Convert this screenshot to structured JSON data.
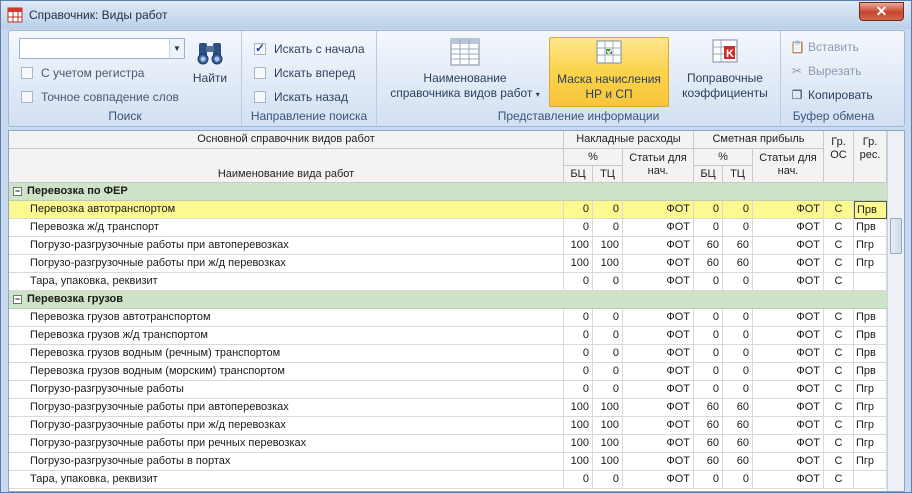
{
  "window": {
    "title": "Справочник: Виды работ",
    "close_glyph": "✕"
  },
  "ribbon": {
    "search": {
      "input_value": "",
      "case_label": "С учетом регистра",
      "exact_label": "Точное совпадение слов",
      "find_label": "Найти",
      "group_label": "Поиск"
    },
    "direction": {
      "from_start": "Искать с начала",
      "forward": "Искать вперед",
      "backward": "Искать назад",
      "group_label": "Направление поиска"
    },
    "view": {
      "name_btn": [
        "Наименование",
        "справочника видов работ"
      ],
      "mask_btn": [
        "Маска начисления",
        "НР и СП"
      ],
      "coef_btn": [
        "Поправочные",
        "коэффициенты"
      ],
      "group_label": "Представление информации"
    },
    "clipboard": {
      "paste": "Вставить",
      "cut": "Вырезать",
      "copy": "Копировать",
      "group_label": "Буфер обмена"
    }
  },
  "grid": {
    "headers": {
      "main": "Основной справочник видов работ",
      "name": "Наименование вида работ",
      "overhead": "Накладные расходы",
      "profit": "Сметная прибыль",
      "pct": "%",
      "pct2": "%",
      "bc": "БЦ",
      "tc": "ТЦ",
      "bc2": "БЦ",
      "tc2": "ТЦ",
      "art": [
        "Статьи для",
        "нач."
      ],
      "art2": [
        "Статьи для",
        "нач."
      ],
      "gr_os": [
        "Гр.",
        "ОС"
      ],
      "gr_res": [
        "Гр.",
        "рес."
      ]
    },
    "groups": [
      {
        "title": "Перевозка по ФЕР",
        "rows": [
          {
            "name": "Перевозка автотранспортом",
            "nr_bc": "0",
            "nr_tc": "0",
            "nr_art": "ФОТ",
            "sp_bc": "0",
            "sp_tc": "0",
            "sp_art": "ФОТ",
            "gr_os": "С",
            "gr_res": "Прв",
            "selected": true
          },
          {
            "name": "Перевозка ж/д транспорт",
            "nr_bc": "0",
            "nr_tc": "0",
            "nr_art": "ФОТ",
            "sp_bc": "0",
            "sp_tc": "0",
            "sp_art": "ФОТ",
            "gr_os": "С",
            "gr_res": "Прв"
          },
          {
            "name": "Погрузо-разгрузочные работы при автоперевозках",
            "nr_bc": "100",
            "nr_tc": "100",
            "nr_art": "ФОТ",
            "sp_bc": "60",
            "sp_tc": "60",
            "sp_art": "ФОТ",
            "gr_os": "С",
            "gr_res": "Пгр"
          },
          {
            "name": "Погрузо-разгрузочные работы при ж/д перевозках",
            "nr_bc": "100",
            "nr_tc": "100",
            "nr_art": "ФОТ",
            "sp_bc": "60",
            "sp_tc": "60",
            "sp_art": "ФОТ",
            "gr_os": "С",
            "gr_res": "Пгр"
          },
          {
            "name": "Тара, упаковка, реквизит",
            "nr_bc": "0",
            "nr_tc": "0",
            "nr_art": "ФОТ",
            "sp_bc": "0",
            "sp_tc": "0",
            "sp_art": "ФОТ",
            "gr_os": "С",
            "gr_res": ""
          }
        ]
      },
      {
        "title": "Перевозка грузов",
        "rows": [
          {
            "name": "Перевозка грузов автотранспортом",
            "nr_bc": "0",
            "nr_tc": "0",
            "nr_art": "ФОТ",
            "sp_bc": "0",
            "sp_tc": "0",
            "sp_art": "ФОТ",
            "gr_os": "С",
            "gr_res": "Прв"
          },
          {
            "name": "Перевозка грузов ж/д транспортом",
            "nr_bc": "0",
            "nr_tc": "0",
            "nr_art": "ФОТ",
            "sp_bc": "0",
            "sp_tc": "0",
            "sp_art": "ФОТ",
            "gr_os": "С",
            "gr_res": "Прв"
          },
          {
            "name": "Перевозка грузов водным (речным) транспортом",
            "nr_bc": "0",
            "nr_tc": "0",
            "nr_art": "ФОТ",
            "sp_bc": "0",
            "sp_tc": "0",
            "sp_art": "ФОТ",
            "gr_os": "С",
            "gr_res": "Прв"
          },
          {
            "name": "Перевозка грузов водным (морским) транспортом",
            "nr_bc": "0",
            "nr_tc": "0",
            "nr_art": "ФОТ",
            "sp_bc": "0",
            "sp_tc": "0",
            "sp_art": "ФОТ",
            "gr_os": "С",
            "gr_res": "Прв"
          },
          {
            "name": "Погрузо-разгрузочные работы",
            "nr_bc": "0",
            "nr_tc": "0",
            "nr_art": "ФОТ",
            "sp_bc": "0",
            "sp_tc": "0",
            "sp_art": "ФОТ",
            "gr_os": "С",
            "gr_res": "Пгр"
          },
          {
            "name": "Погрузо-разгрузочные работы при автоперевозках",
            "nr_bc": "100",
            "nr_tc": "100",
            "nr_art": "ФОТ",
            "sp_bc": "60",
            "sp_tc": "60",
            "sp_art": "ФОТ",
            "gr_os": "С",
            "gr_res": "Пгр"
          },
          {
            "name": "Погрузо-разгрузочные работы при ж/д перевозках",
            "nr_bc": "100",
            "nr_tc": "100",
            "nr_art": "ФОТ",
            "sp_bc": "60",
            "sp_tc": "60",
            "sp_art": "ФОТ",
            "gr_os": "С",
            "gr_res": "Пгр"
          },
          {
            "name": "Погрузо-разгрузочные работы при речных перевозках",
            "nr_bc": "100",
            "nr_tc": "100",
            "nr_art": "ФОТ",
            "sp_bc": "60",
            "sp_tc": "60",
            "sp_art": "ФОТ",
            "gr_os": "С",
            "gr_res": "Пгр"
          },
          {
            "name": "Погрузо-разгрузочные работы в портах",
            "nr_bc": "100",
            "nr_tc": "100",
            "nr_art": "ФОТ",
            "sp_bc": "60",
            "sp_tc": "60",
            "sp_art": "ФОТ",
            "gr_os": "С",
            "gr_res": "Пгр"
          },
          {
            "name": "Тара, упаковка, реквизит",
            "nr_bc": "0",
            "nr_tc": "0",
            "nr_art": "ФОТ",
            "sp_bc": "0",
            "sp_tc": "0",
            "sp_art": "ФОТ",
            "gr_os": "С",
            "gr_res": ""
          }
        ]
      }
    ]
  }
}
